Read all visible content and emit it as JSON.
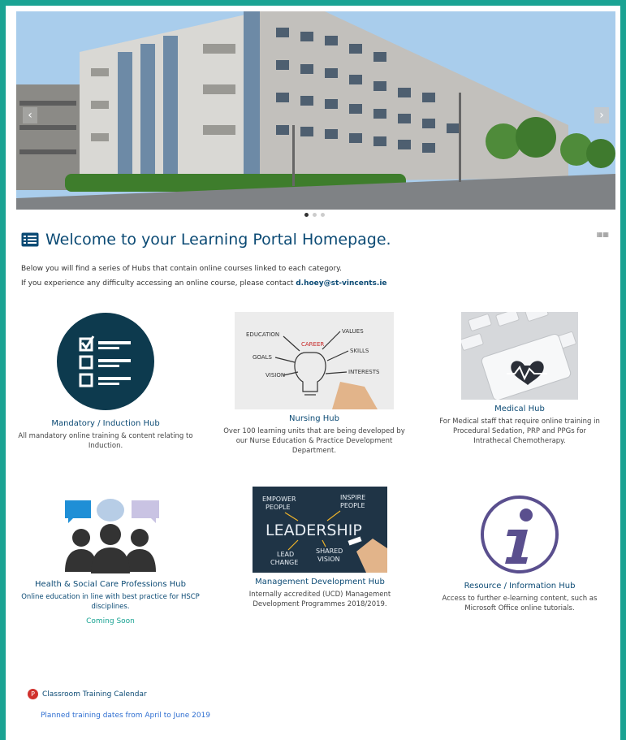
{
  "welcome": {
    "title": "Welcome to your Learning Portal Homepage.",
    "intro_line1": "Below you will find a series of Hubs that contain online courses linked to each category.",
    "intro_line2_prefix": "If you experience any difficulty accessing an online course, please contact ",
    "contact_email": "d.hoey@st-vincents.ie"
  },
  "hubs": {
    "mandatory": {
      "title": "Mandatory / Induction Hub",
      "desc": "All mandatory online training & content relating to Induction."
    },
    "nursing": {
      "title": "Nursing Hub",
      "desc": "Over 100 learning units that are being developed by our Nurse Education & Practice Development Department.",
      "image_words": {
        "education": "EDUCATION",
        "values": "VALUES",
        "career": "CAREER",
        "goals": "GOALS",
        "skills": "SKILLS",
        "vision": "VISION",
        "interests": "INTERESTS"
      }
    },
    "medical": {
      "title": "Medical Hub",
      "desc": "For Medical staff that require online training in Procedural Sedation, PRP and PPGs for Intrathecal Chemotherapy."
    },
    "hscp": {
      "title": "Health & Social Care Professions Hub",
      "desc": "Online education in line with best practice for HSCP disciplines.",
      "coming": "Coming Soon"
    },
    "management": {
      "title": "Management Development Hub",
      "desc": "Internally accredited (UCD) Management Development Programmes 2018/2019.",
      "image_words": {
        "empower": "EMPOWER",
        "people1": "PEOPLE",
        "inspire": "INSPIRE",
        "people2": "PEOPLE",
        "leadership": "LEADERSHIP",
        "lead": "LEAD",
        "change": "CHANGE",
        "shared": "SHARED",
        "vision": "VISION"
      }
    },
    "resource": {
      "title": "Resource / Information Hub",
      "desc": "Access to further e-learning content, such as Microsoft Office online tutorials."
    }
  },
  "calendar": {
    "label": "Classroom Training Calendar",
    "sub": "Planned training dates from April to June 2019"
  },
  "colors": {
    "accent": "#1aa393",
    "title_blue": "#0b4a74",
    "link_blue": "#2f6fd1",
    "calendar_red": "#d0312d"
  },
  "icons": {
    "next": "chevron-right-icon",
    "welcome": "list-icon",
    "calendar": "calendar-icon"
  }
}
